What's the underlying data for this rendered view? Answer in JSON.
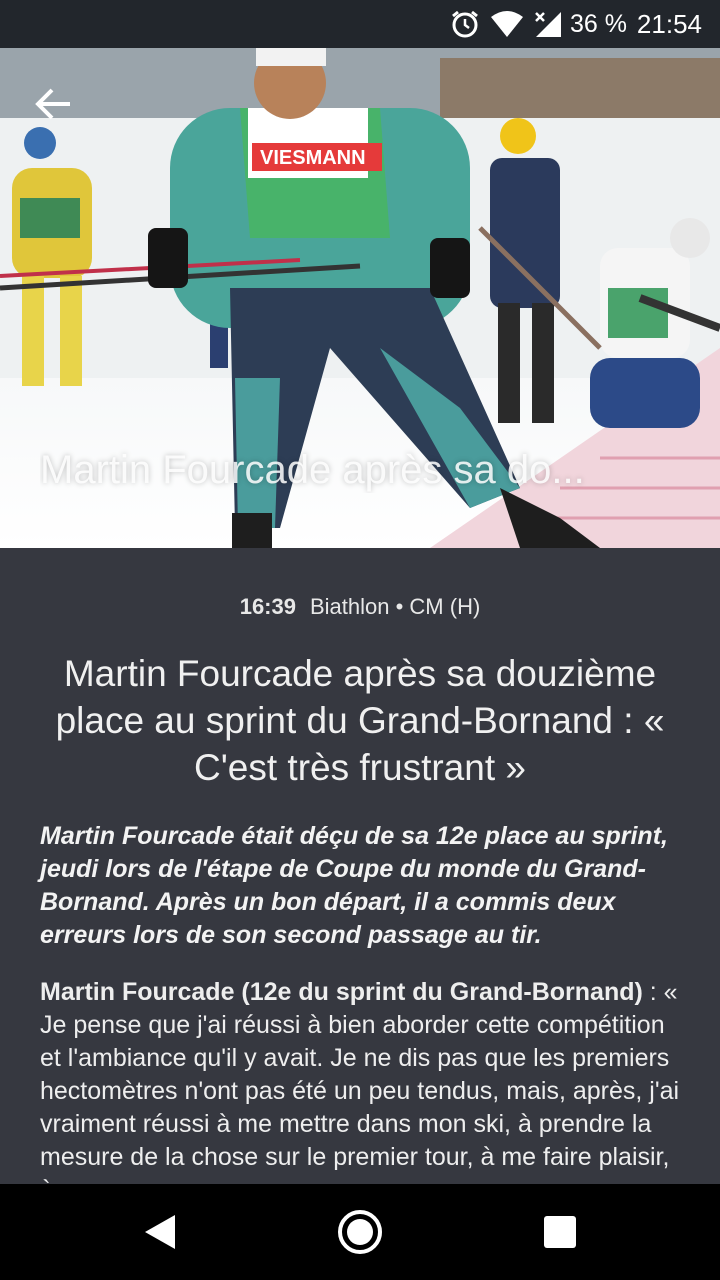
{
  "status_bar": {
    "battery": "36 %",
    "time": "21:54",
    "icons": [
      "alarm-icon",
      "wifi-icon",
      "signal-icon"
    ]
  },
  "hero": {
    "overlay_title": "Martin Fourcade après sa do..."
  },
  "article": {
    "time": "16:39",
    "category": "Biathlon • CM (H)",
    "headline": "Martin Fourcade après sa douzième place au sprint du Grand-Bornand : « C'est très frustrant »",
    "lead": "Martin Fourcade était déçu de sa 12e place au sprint, jeudi lors de l'étape de Coupe du monde du Grand-Bornand. Après un bon départ, il a commis deux erreurs lors de son second passage au tir.",
    "body_speaker": "Martin Fourcade (12e du sprint du Grand-Bornand)",
    "body_text": " : « Je pense que j'ai réussi à bien aborder cette compétition et l'ambiance qu'il y avait. Je ne dis pas que les premiers hectomètres n'ont pas été un peu tendus, mais, après, j'ai vraiment réussi à me mettre dans mon ski, à prendre la mesure de la chose sur le premier tour, à me faire plaisir, à"
  },
  "nav": [
    "back-nav-icon",
    "home-nav-icon",
    "recents-nav-icon"
  ]
}
